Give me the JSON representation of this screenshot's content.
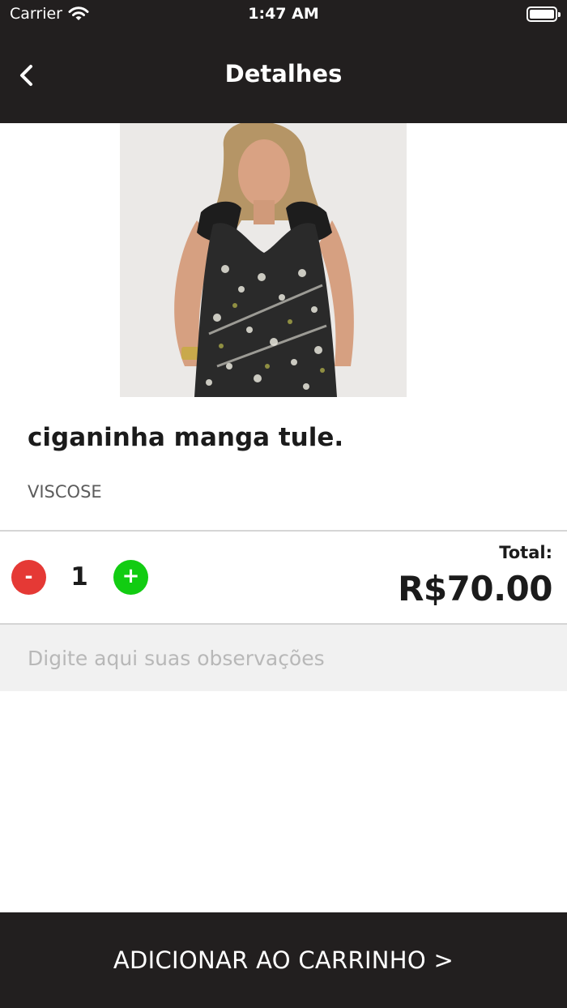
{
  "status_bar": {
    "carrier": "Carrier",
    "time": "1:47 AM"
  },
  "nav": {
    "title": "Detalhes",
    "back_icon": "chevron-left-icon"
  },
  "product": {
    "name": "ciganinha manga tule.",
    "material": "VISCOSE"
  },
  "quantity": {
    "minus_label": "-",
    "value": "1",
    "plus_label": "+"
  },
  "total": {
    "label": "Total:",
    "value": "R$70.00"
  },
  "observations": {
    "placeholder": "Digite aqui suas observações",
    "value": ""
  },
  "footer": {
    "add_to_cart_label": "ADICIONAR AO CARRINHO >"
  },
  "colors": {
    "header_bg": "#221f1f",
    "minus_button": "#e53935",
    "plus_button": "#12cc12",
    "observations_bg": "#f1f1f1"
  }
}
